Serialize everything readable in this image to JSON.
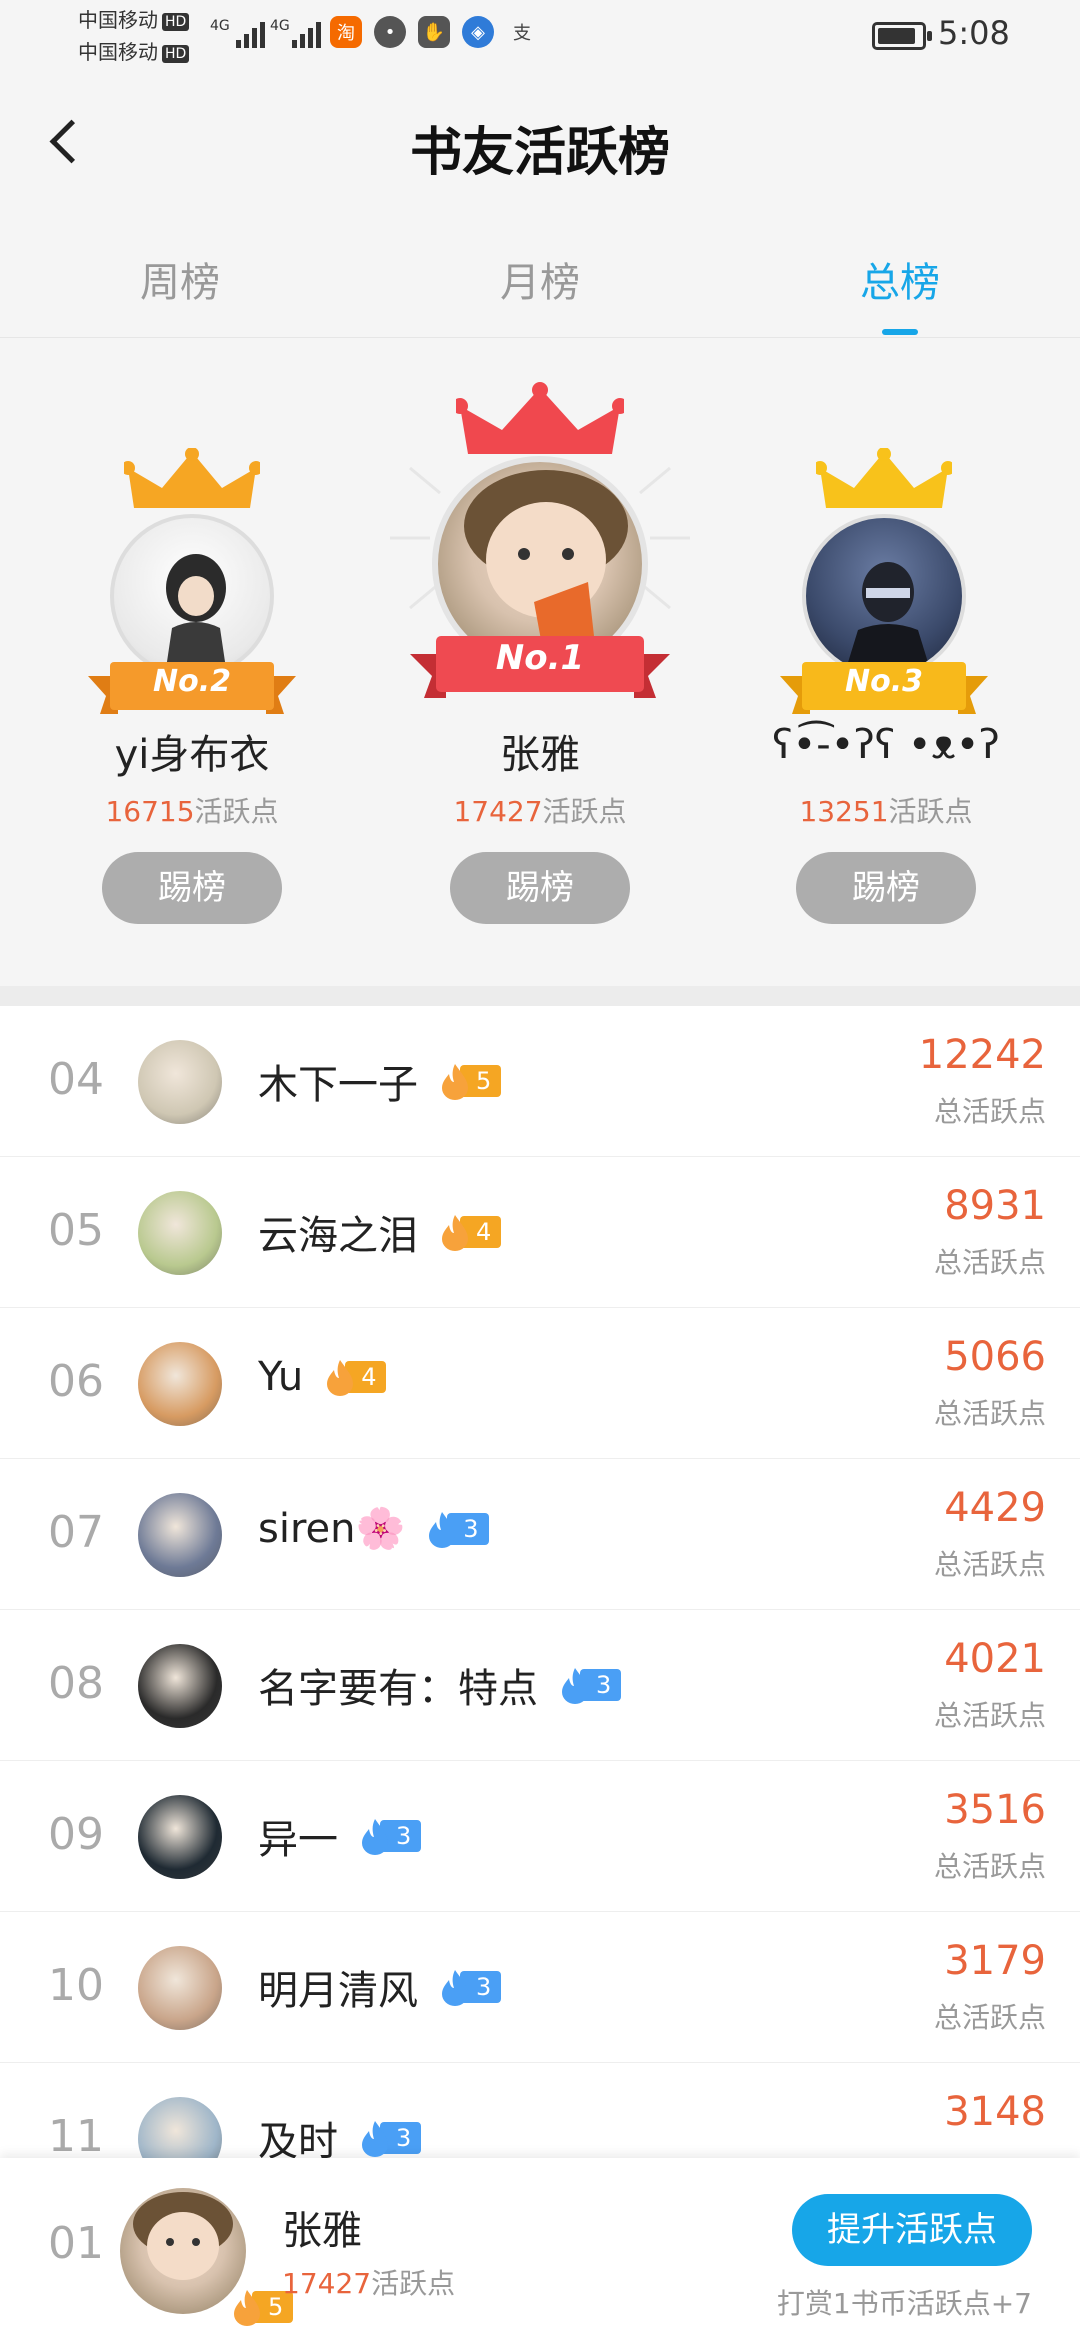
{
  "status_bar": {
    "carrier1": "中国移动",
    "carrier2": "中国移动",
    "hd": "HD",
    "net1": "4G",
    "net2": "4G",
    "time": "5:08",
    "battery_level": 0.85,
    "icons": [
      "taobao-icon",
      "message-icon",
      "hand-icon",
      "browser-icon",
      "alipay-icon"
    ]
  },
  "header": {
    "title": "书友活跃榜"
  },
  "tabs": [
    {
      "label": "周榜",
      "active": false
    },
    {
      "label": "月榜",
      "active": false
    },
    {
      "label": "总榜",
      "active": true
    }
  ],
  "podium": [
    {
      "rank_label": "No.2",
      "name": "yi身布衣",
      "points": "16715",
      "points_suffix": "活跃点",
      "kick_label": "踢榜",
      "crown_color": "#f6a623",
      "ribbon_color": "#f59a2b"
    },
    {
      "rank_label": "No.1",
      "name": "张雅",
      "points": "17427",
      "points_suffix": "活跃点",
      "kick_label": "踢榜",
      "crown_color": "#f0484e",
      "ribbon_color": "#ef4a51"
    },
    {
      "rank_label": "No.3",
      "name": "ʕ•͡-•ʔʕ •ᴥ•ʔ",
      "points": "13251",
      "points_suffix": "活跃点",
      "kick_label": "踢榜",
      "crown_color": "#f8c21b",
      "ribbon_color": "#f8b91b"
    }
  ],
  "list": [
    {
      "rank": "04",
      "name": "木下一子",
      "level": "5",
      "level_color": "orange",
      "score": "12242",
      "label": "总活跃点"
    },
    {
      "rank": "05",
      "name": "云海之泪",
      "level": "4",
      "level_color": "orange",
      "score": "8931",
      "label": "总活跃点"
    },
    {
      "rank": "06",
      "name": "Yu",
      "level": "4",
      "level_color": "orange",
      "score": "5066",
      "label": "总活跃点"
    },
    {
      "rank": "07",
      "name": "siren🌸",
      "level": "3",
      "level_color": "blue",
      "score": "4429",
      "label": "总活跃点"
    },
    {
      "rank": "08",
      "name": "名字要有：特点",
      "level": "3",
      "level_color": "blue",
      "score": "4021",
      "label": "总活跃点"
    },
    {
      "rank": "09",
      "name": "异一",
      "level": "3",
      "level_color": "blue",
      "score": "3516",
      "label": "总活跃点"
    },
    {
      "rank": "10",
      "name": "明月清风",
      "level": "3",
      "level_color": "blue",
      "score": "3179",
      "label": "总活跃点"
    },
    {
      "rank": "11",
      "name": "及时",
      "level": "3",
      "level_color": "blue",
      "score": "3148",
      "label": ""
    }
  ],
  "bottom_bar": {
    "rank": "01",
    "name": "张雅",
    "level": "5",
    "points": "17427",
    "points_suffix": "活跃点",
    "button_label": "提升活跃点",
    "note": "打赏1书币活跃点+7"
  },
  "colors": {
    "accent": "#17a6e8",
    "score": "#e8643c"
  }
}
